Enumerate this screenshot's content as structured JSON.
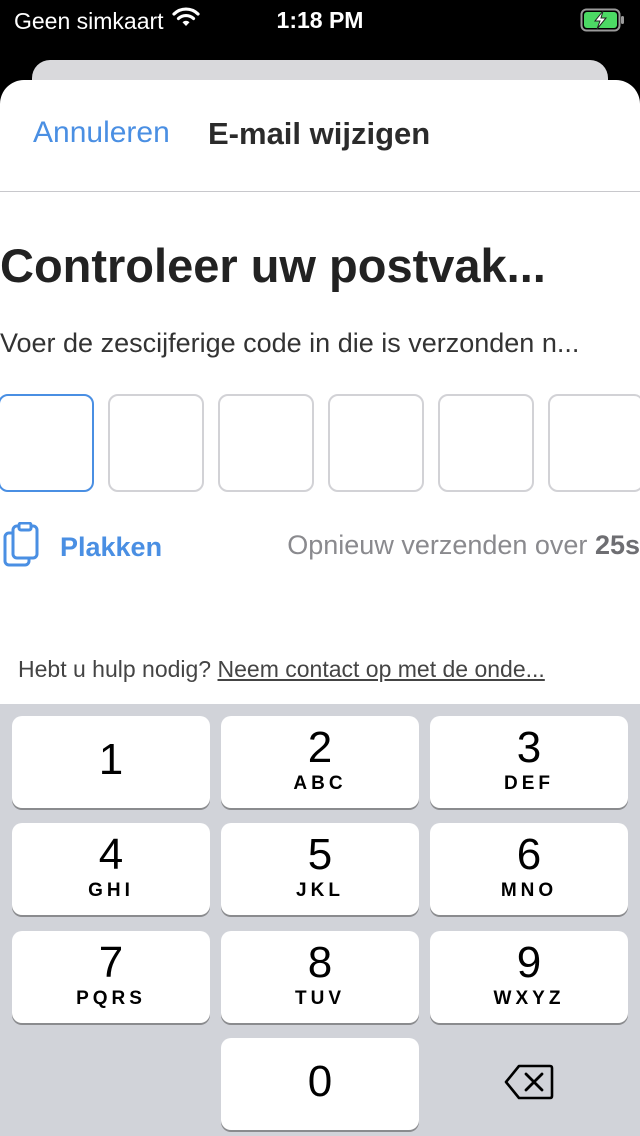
{
  "status_bar": {
    "carrier": "Geen simkaart",
    "time": "1:18 PM",
    "battery_icon": "battery-charging-icon",
    "wifi_icon": "wifi-icon"
  },
  "nav": {
    "cancel_label": "Annuleren",
    "title": "E-mail wijzigen"
  },
  "main": {
    "heading": "Controleer uw postvak...",
    "instruction": "Voer de zescijferige code in die is verzonden n...",
    "code_digits": [
      "",
      "",
      "",
      "",
      "",
      ""
    ],
    "paste_label": "Plakken",
    "paste_icon": "clipboard-icon",
    "resend_prefix": "Opnieuw verzenden over ",
    "resend_countdown": "25s"
  },
  "help": {
    "prefix": "Hebt u hulp nodig? ",
    "link": "Neem contact op met de onde..."
  },
  "keyboard": {
    "keys": [
      {
        "digit": "1",
        "letters": ""
      },
      {
        "digit": "2",
        "letters": "ABC"
      },
      {
        "digit": "3",
        "letters": "DEF"
      },
      {
        "digit": "4",
        "letters": "GHI"
      },
      {
        "digit": "5",
        "letters": "JKL"
      },
      {
        "digit": "6",
        "letters": "MNO"
      },
      {
        "digit": "7",
        "letters": "PQRS"
      },
      {
        "digit": "8",
        "letters": "TUV"
      },
      {
        "digit": "9",
        "letters": "WXYZ"
      },
      {
        "digit": "0",
        "letters": ""
      }
    ],
    "delete_icon": "backspace-icon"
  },
  "colors": {
    "accent": "#4a8fe3",
    "keyboard_bg": "#d1d3d9"
  }
}
